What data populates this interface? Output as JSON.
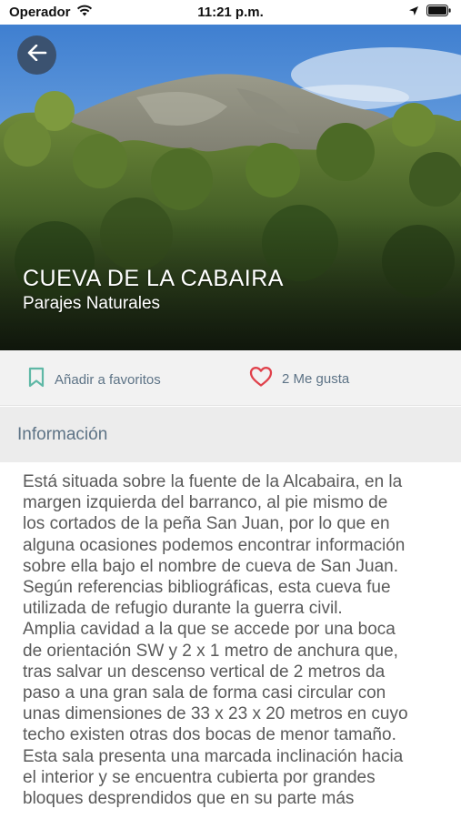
{
  "status_bar": {
    "carrier": "Operador",
    "time": "11:21 p.m.",
    "icons": [
      "wifi-icon",
      "location-arrow-icon",
      "battery-icon"
    ]
  },
  "hero": {
    "title": "CUEVA DE LA CABAIRA",
    "subtitle": "Parajes Naturales",
    "back_icon": "arrow-left-icon"
  },
  "actions": {
    "favorite_label": "Añadir a favoritos",
    "favorite_icon": "bookmark-icon",
    "like_label": "2 Me gusta",
    "like_icon": "heart-icon"
  },
  "section": {
    "title": "Información"
  },
  "description": "Está situada sobre la fuente de la Alcabaira, en la\nmargen izquierda del barranco, al pie mismo de\nlos cortados de la peña San Juan, por lo que en\nalguna ocasiones podemos encontrar información\nsobre ella bajo el nombre de cueva de San Juan.\n Según referencias bibliográficas, esta cueva fue\nutilizada de refugio durante la guerra civil.\nAmplia cavidad a la que se accede por una boca\nde orientación SW y 2 x 1 metro de anchura que,\ntras salvar un descenso vertical de 2 metros da\npaso a una gran sala de forma casi circular con\nunas dimensiones de 33 x 23 x 20 metros en cuyo\ntecho existen otras dos bocas de menor tamaño.\n Esta sala presenta una marcada inclinación hacia\nel interior y se encuentra cubierta por grandes\nbloques desprendidos que en su parte más",
  "colors": {
    "accent_green": "#5fb8a6",
    "heart_red": "#e0414b",
    "muted_text": "#5d7386",
    "back_button": "#3b5270"
  }
}
